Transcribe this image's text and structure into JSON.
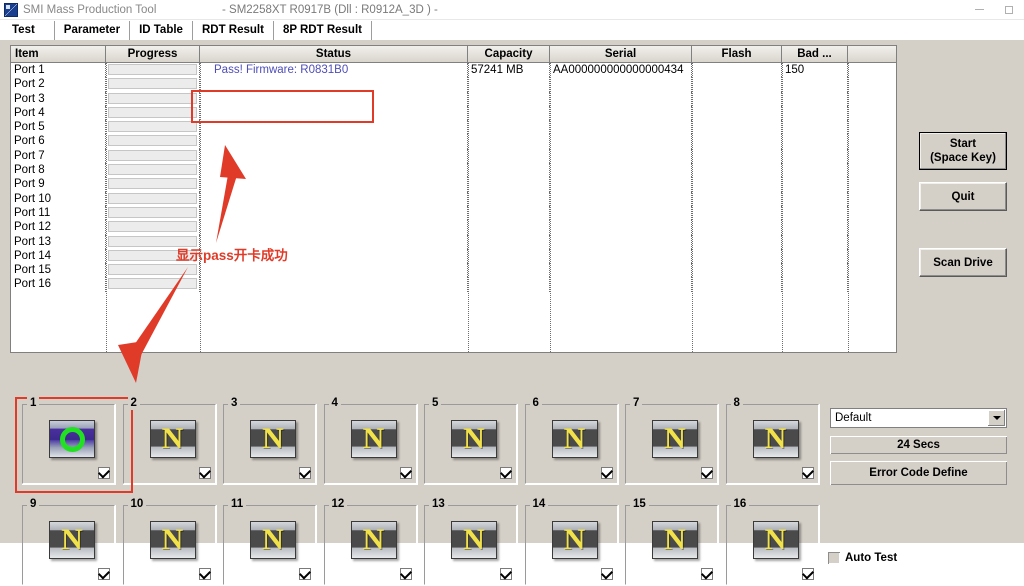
{
  "window": {
    "title": "SMI Mass Production Tool",
    "subtitle": "- SM2258XT    R0917B     (Dll : R0912A_3D ) -",
    "minimize_label": "Minimize",
    "maximize_label": "Maximize"
  },
  "tabs": [
    {
      "label": "Test",
      "active": true
    },
    {
      "label": "Parameter",
      "active": false
    },
    {
      "label": "ID Table",
      "active": false
    },
    {
      "label": "RDT Result",
      "active": false
    },
    {
      "label": "8P RDT Result",
      "active": false
    }
  ],
  "table": {
    "columns": [
      "Item",
      "Progress",
      "Status",
      "Capacity",
      "Serial",
      "Flash",
      "Bad ...",
      ""
    ],
    "rows": [
      {
        "item": "Port 1",
        "progress": "",
        "status": "Pass! Firmware: R0831B0",
        "capacity": "57241 MB",
        "serial": "AA000000000000000434",
        "flash": "",
        "bad": "150"
      },
      {
        "item": "Port 2",
        "progress": "",
        "status": "",
        "capacity": "",
        "serial": "",
        "flash": "",
        "bad": ""
      },
      {
        "item": "Port 3",
        "progress": "",
        "status": "",
        "capacity": "",
        "serial": "",
        "flash": "",
        "bad": ""
      },
      {
        "item": "Port 4",
        "progress": "",
        "status": "",
        "capacity": "",
        "serial": "",
        "flash": "",
        "bad": ""
      },
      {
        "item": "Port 5",
        "progress": "",
        "status": "",
        "capacity": "",
        "serial": "",
        "flash": "",
        "bad": ""
      },
      {
        "item": "Port 6",
        "progress": "",
        "status": "",
        "capacity": "",
        "serial": "",
        "flash": "",
        "bad": ""
      },
      {
        "item": "Port 7",
        "progress": "",
        "status": "",
        "capacity": "",
        "serial": "",
        "flash": "",
        "bad": ""
      },
      {
        "item": "Port 8",
        "progress": "",
        "status": "",
        "capacity": "",
        "serial": "",
        "flash": "",
        "bad": ""
      },
      {
        "item": "Port 9",
        "progress": "",
        "status": "",
        "capacity": "",
        "serial": "",
        "flash": "",
        "bad": ""
      },
      {
        "item": "Port 10",
        "progress": "",
        "status": "",
        "capacity": "",
        "serial": "",
        "flash": "",
        "bad": ""
      },
      {
        "item": "Port 11",
        "progress": "",
        "status": "",
        "capacity": "",
        "serial": "",
        "flash": "",
        "bad": ""
      },
      {
        "item": "Port 12",
        "progress": "",
        "status": "",
        "capacity": "",
        "serial": "",
        "flash": "",
        "bad": ""
      },
      {
        "item": "Port 13",
        "progress": "",
        "status": "",
        "capacity": "",
        "serial": "",
        "flash": "",
        "bad": ""
      },
      {
        "item": "Port 14",
        "progress": "",
        "status": "",
        "capacity": "",
        "serial": "",
        "flash": "",
        "bad": ""
      },
      {
        "item": "Port 15",
        "progress": "",
        "status": "",
        "capacity": "",
        "serial": "",
        "flash": "",
        "bad": ""
      },
      {
        "item": "Port 16",
        "progress": "",
        "status": "",
        "capacity": "",
        "serial": "",
        "flash": "",
        "bad": ""
      }
    ]
  },
  "buttons": {
    "start_line1": "Start",
    "start_line2": "(Space Key)",
    "quit": "Quit",
    "scan_drive": "Scan Drive",
    "error_code_define": "Error Code Define"
  },
  "controls": {
    "preset_selected": "Default",
    "elapsed": "24 Secs",
    "auto_test_label": "Auto Test",
    "auto_test_checked": false
  },
  "slots": [
    {
      "num": "1",
      "state": "O",
      "checked": true
    },
    {
      "num": "2",
      "state": "N",
      "checked": true
    },
    {
      "num": "3",
      "state": "N",
      "checked": true
    },
    {
      "num": "4",
      "state": "N",
      "checked": true
    },
    {
      "num": "5",
      "state": "N",
      "checked": true
    },
    {
      "num": "6",
      "state": "N",
      "checked": true
    },
    {
      "num": "7",
      "state": "N",
      "checked": true
    },
    {
      "num": "8",
      "state": "N",
      "checked": true
    },
    {
      "num": "9",
      "state": "N",
      "checked": true
    },
    {
      "num": "10",
      "state": "N",
      "checked": true
    },
    {
      "num": "11",
      "state": "N",
      "checked": true
    },
    {
      "num": "12",
      "state": "N",
      "checked": true
    },
    {
      "num": "13",
      "state": "N",
      "checked": true
    },
    {
      "num": "14",
      "state": "N",
      "checked": true
    },
    {
      "num": "15",
      "state": "N",
      "checked": true
    },
    {
      "num": "16",
      "state": "N",
      "checked": true
    }
  ],
  "annotations": {
    "note_text": "显示pass开卡成功",
    "highlight_color": "#e03b28"
  }
}
